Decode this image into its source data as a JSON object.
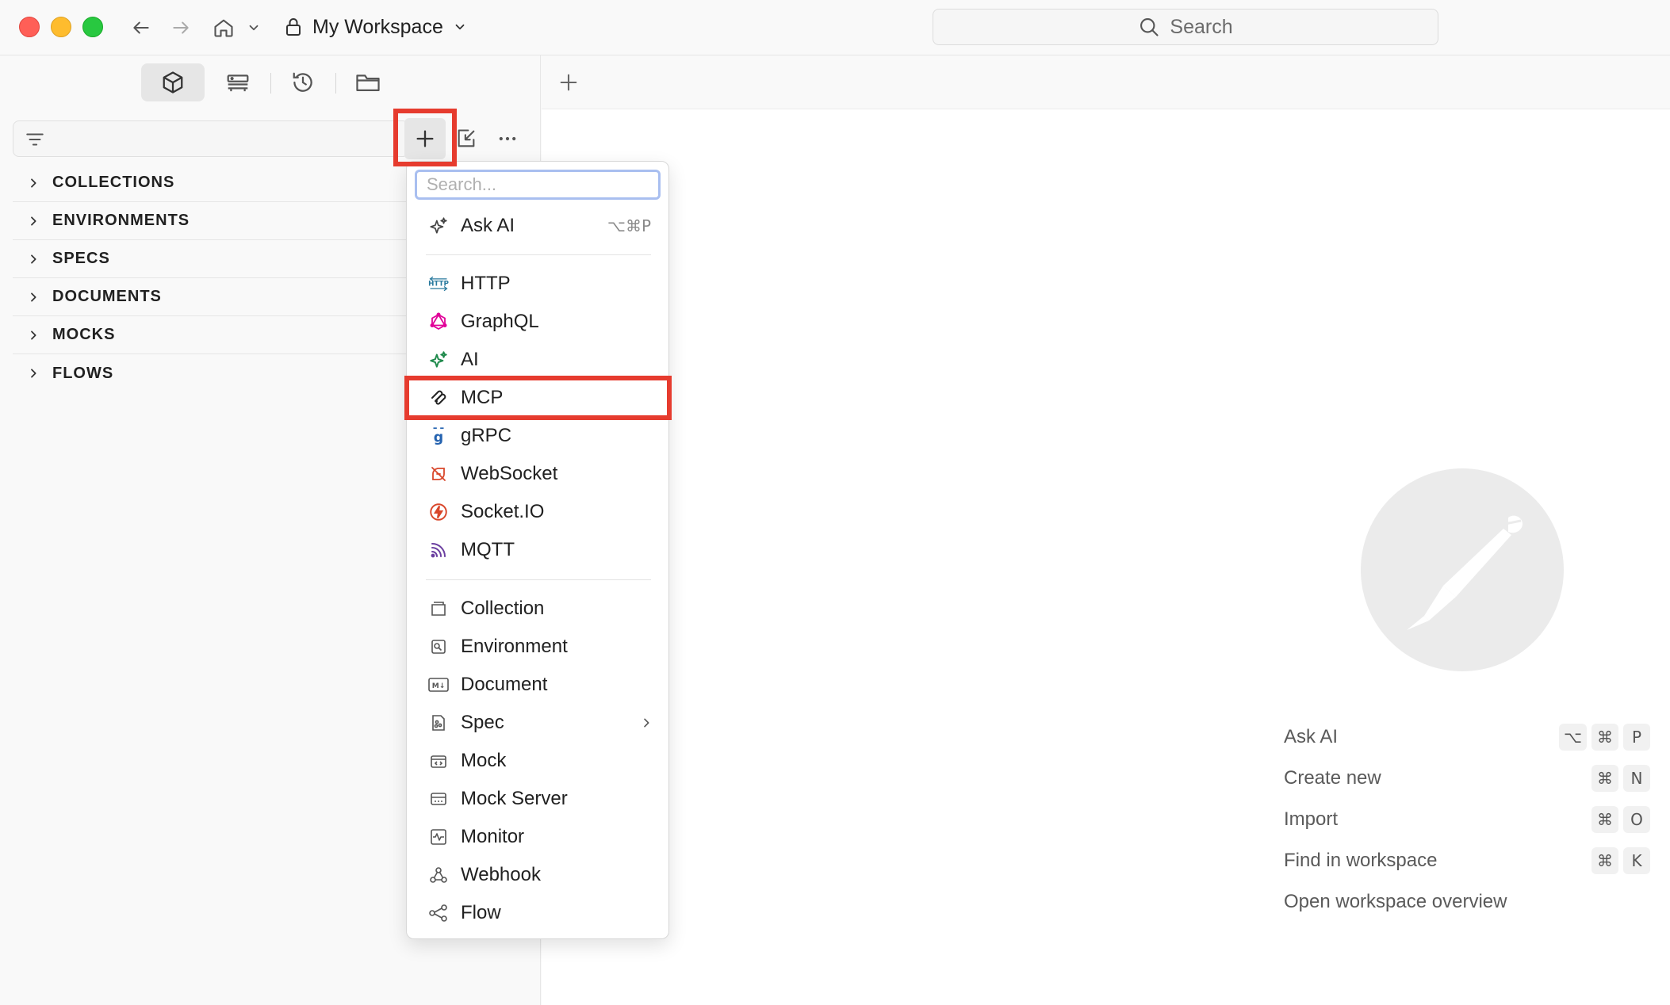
{
  "titlebar": {
    "workspace_name": "My Workspace",
    "search_label": "Search"
  },
  "sidebar": {
    "tree": [
      {
        "label": "COLLECTIONS"
      },
      {
        "label": "ENVIRONMENTS"
      },
      {
        "label": "SPECS"
      },
      {
        "label": "DOCUMENTS"
      },
      {
        "label": "MOCKS"
      },
      {
        "label": "FLOWS"
      }
    ]
  },
  "dropdown": {
    "search_placeholder": "Search...",
    "ask_ai": {
      "label": "Ask AI",
      "shortcut": "⌥⌘P"
    },
    "protocols": [
      {
        "label": "HTTP",
        "icon": "http-icon"
      },
      {
        "label": "GraphQL",
        "icon": "graphql-icon"
      },
      {
        "label": "AI",
        "icon": "ai-sparkle-icon"
      },
      {
        "label": "MCP",
        "icon": "mcp-icon"
      },
      {
        "label": "gRPC",
        "icon": "grpc-icon"
      },
      {
        "label": "WebSocket",
        "icon": "websocket-icon"
      },
      {
        "label": "Socket.IO",
        "icon": "socketio-icon"
      },
      {
        "label": "MQTT",
        "icon": "mqtt-icon"
      }
    ],
    "entities": [
      {
        "label": "Collection",
        "icon": "collection-icon"
      },
      {
        "label": "Environment",
        "icon": "environment-icon"
      },
      {
        "label": "Document",
        "icon": "document-icon"
      },
      {
        "label": "Spec",
        "icon": "spec-icon"
      },
      {
        "label": "Mock",
        "icon": "mock-icon"
      },
      {
        "label": "Mock Server",
        "icon": "mock-server-icon"
      },
      {
        "label": "Monitor",
        "icon": "monitor-icon"
      },
      {
        "label": "Webhook",
        "icon": "webhook-icon"
      },
      {
        "label": "Flow",
        "icon": "flow-icon"
      }
    ]
  },
  "main": {
    "shortcuts": [
      {
        "label": "Ask AI",
        "keys": [
          "⌥",
          "⌘",
          "P"
        ]
      },
      {
        "label": "Create new",
        "keys": [
          "⌘",
          "N"
        ]
      },
      {
        "label": "Import",
        "keys": [
          "⌘",
          "O"
        ]
      },
      {
        "label": "Find in workspace",
        "keys": [
          "⌘",
          "K"
        ]
      },
      {
        "label": "Open workspace overview",
        "keys": []
      }
    ]
  },
  "colors": {
    "highlight": "#e63b2e",
    "http": "#2a7a9e",
    "graphql": "#e10098",
    "ai": "#1f8a4c",
    "grpc": "#2563b0",
    "websocket": "#d9472b",
    "socketio": "#d9472b",
    "mqtt": "#6b3fa0"
  }
}
